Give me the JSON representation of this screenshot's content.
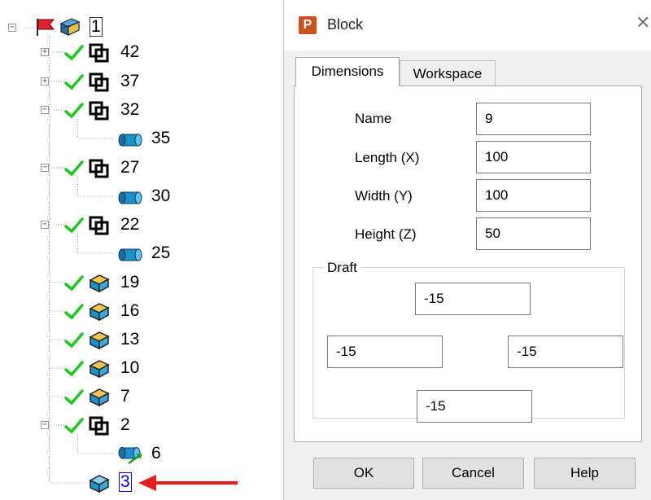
{
  "tree": {
    "root": {
      "label": "1"
    },
    "nodes": [
      {
        "label": "42",
        "icon": "toolpath-icon"
      },
      {
        "label": "37",
        "icon": "toolpath-icon"
      },
      {
        "label": "32",
        "icon": "toolpath-icon"
      },
      {
        "label": "35",
        "icon": "cylinder-block-icon"
      },
      {
        "label": "27",
        "icon": "toolpath-icon"
      },
      {
        "label": "30",
        "icon": "cylinder-block-icon"
      },
      {
        "label": "22",
        "icon": "toolpath-icon"
      },
      {
        "label": "25",
        "icon": "cylinder-block-icon"
      },
      {
        "label": "19",
        "icon": "box-block-icon"
      },
      {
        "label": "16",
        "icon": "box-block-icon"
      },
      {
        "label": "13",
        "icon": "box-block-icon"
      },
      {
        "label": "10",
        "icon": "box-block-icon"
      },
      {
        "label": "7",
        "icon": "box-block-icon"
      },
      {
        "label": "2",
        "icon": "toolpath-icon"
      },
      {
        "label": "6",
        "icon": "cylinder-block-icon"
      },
      {
        "label": "3",
        "icon": "box-block-icon"
      }
    ]
  },
  "dialog": {
    "title": "Block",
    "tabs": [
      "Dimensions",
      "Workspace"
    ],
    "fields": {
      "name": {
        "label": "Name",
        "value": "9"
      },
      "length": {
        "label": "Length (X)",
        "value": "100"
      },
      "width": {
        "label": "Width (Y)",
        "value": "100"
      },
      "height": {
        "label": "Height (Z)",
        "value": "50"
      }
    },
    "draft": {
      "label": "Draft",
      "top": "-15",
      "left": "-15",
      "right": "-15",
      "bottom": "-15"
    },
    "buttons": {
      "ok": "OK",
      "cancel": "Cancel",
      "help": "Help"
    }
  },
  "colors": {
    "check": "#1ec81e",
    "arrow": "#e02020",
    "block": "#1f8fc8",
    "selection": "#0000c8"
  }
}
